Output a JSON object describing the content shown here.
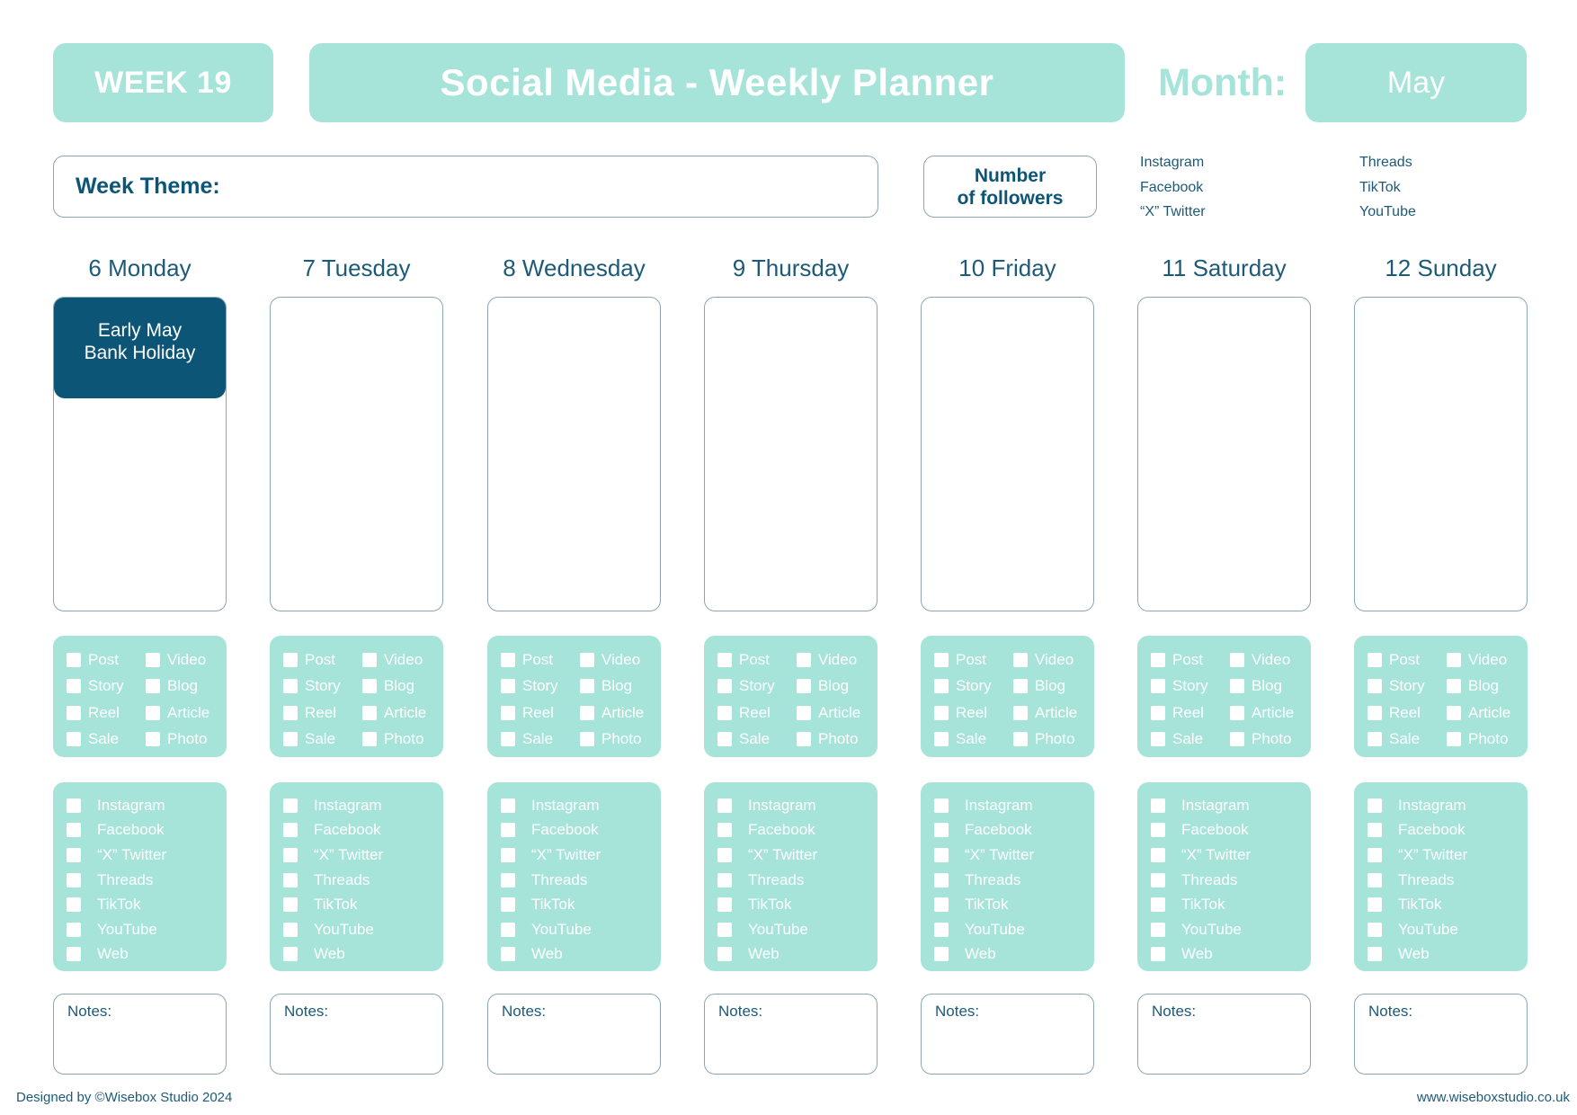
{
  "header": {
    "week": "WEEK 19",
    "title": "Social Media - Weekly Planner",
    "month_label": "Month:",
    "month_value": "May"
  },
  "theme": {
    "label": "Week Theme:"
  },
  "followers": {
    "line1": "Number",
    "line2": "of followers"
  },
  "platform_legend": {
    "col1": [
      "Instagram",
      "Facebook",
      "“X” Twitter"
    ],
    "col2": [
      "Threads",
      "TikTok",
      "YouTube"
    ]
  },
  "colors": {
    "accent_teal": "#a6e4da",
    "dark_blue": "#0d5577",
    "text_blue": "#1d5a78"
  },
  "content_types": [
    "Post",
    "Video",
    "Story",
    "Blog",
    "Reel",
    "Article",
    "Sale",
    "Photo"
  ],
  "platforms": [
    "Instagram",
    "Facebook",
    "“X” Twitter",
    "Threads",
    "TikTok",
    "YouTube",
    "Web"
  ],
  "notes_label": "Notes:",
  "days": [
    {
      "label": "6 Monday",
      "holiday": "Early May Bank Holiday"
    },
    {
      "label": "7 Tuesday",
      "holiday": null
    },
    {
      "label": "8 Wednesday",
      "holiday": null
    },
    {
      "label": "9 Thursday",
      "holiday": null
    },
    {
      "label": "10 Friday",
      "holiday": null
    },
    {
      "label": "11 Saturday",
      "holiday": null
    },
    {
      "label": "12 Sunday",
      "holiday": null
    }
  ],
  "footer": {
    "credit": "Designed by ©Wisebox Studio 2024",
    "url": "www.wiseboxstudio.co.uk"
  }
}
